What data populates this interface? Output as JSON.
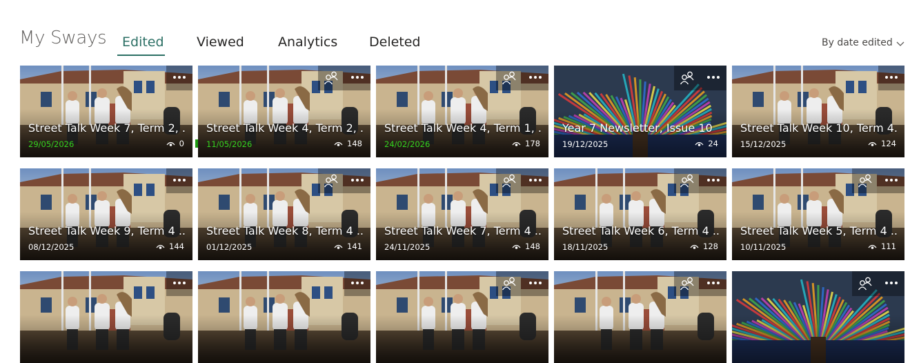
{
  "header": {
    "title": "My Sways",
    "tabs": [
      {
        "label": "Edited",
        "active": true
      },
      {
        "label": "Viewed",
        "active": false
      },
      {
        "label": "Analytics",
        "active": false
      },
      {
        "label": "Deleted",
        "active": false
      }
    ],
    "sort_label": "By date edited"
  },
  "colors": {
    "accent": "#2b6f64",
    "recent_date": "#34d31f"
  },
  "cards": [
    {
      "title": "Street Talk Week 7, Term 2, ...",
      "date": "29/05/2026",
      "views": "0",
      "shared": false,
      "recent": true,
      "thumb": "school"
    },
    {
      "title": "Street Talk Week 4, Term 2, ...",
      "date": "11/05/2026",
      "views": "148",
      "shared": true,
      "recent": true,
      "thumb": "school"
    },
    {
      "title": "Street Talk Week 4, Term 1, ...",
      "date": "24/02/2026",
      "views": "178",
      "shared": true,
      "recent": true,
      "thumb": "school"
    },
    {
      "title": "Year 7 Newsletter, Issue 10",
      "date": "19/12/2025",
      "views": "24",
      "shared": true,
      "recent": false,
      "thumb": "tree"
    },
    {
      "title": "Street Talk Week 10, Term 4...",
      "date": "15/12/2025",
      "views": "124",
      "shared": false,
      "recent": false,
      "thumb": "school"
    },
    {
      "title": "Street Talk Week 9, Term 4 ...",
      "date": "08/12/2025",
      "views": "144",
      "shared": false,
      "recent": false,
      "thumb": "school"
    },
    {
      "title": "Street Talk Week 8, Term 4 ...",
      "date": "01/12/2025",
      "views": "141",
      "shared": true,
      "recent": false,
      "thumb": "school"
    },
    {
      "title": "Street Talk Week 7, Term 4 ...",
      "date": "24/11/2025",
      "views": "148",
      "shared": true,
      "recent": false,
      "thumb": "school"
    },
    {
      "title": "Street Talk Week 6, Term 4 ...",
      "date": "18/11/2025",
      "views": "128",
      "shared": true,
      "recent": false,
      "thumb": "school"
    },
    {
      "title": "Street Talk Week 5, Term 4 ...",
      "date": "10/11/2025",
      "views": "111",
      "shared": true,
      "recent": false,
      "thumb": "school"
    },
    {
      "title": "",
      "date": "",
      "views": "",
      "shared": false,
      "recent": false,
      "thumb": "school"
    },
    {
      "title": "",
      "date": "",
      "views": "",
      "shared": false,
      "recent": false,
      "thumb": "school"
    },
    {
      "title": "",
      "date": "",
      "views": "",
      "shared": true,
      "recent": false,
      "thumb": "school"
    },
    {
      "title": "",
      "date": "",
      "views": "",
      "shared": true,
      "recent": false,
      "thumb": "school"
    },
    {
      "title": "",
      "date": "",
      "views": "",
      "shared": true,
      "recent": false,
      "thumb": "tree"
    }
  ],
  "icons": {
    "sort": "chevron-down-icon",
    "more": "more-options-icon",
    "shared": "shared-people-icon",
    "views": "eye-icon"
  }
}
